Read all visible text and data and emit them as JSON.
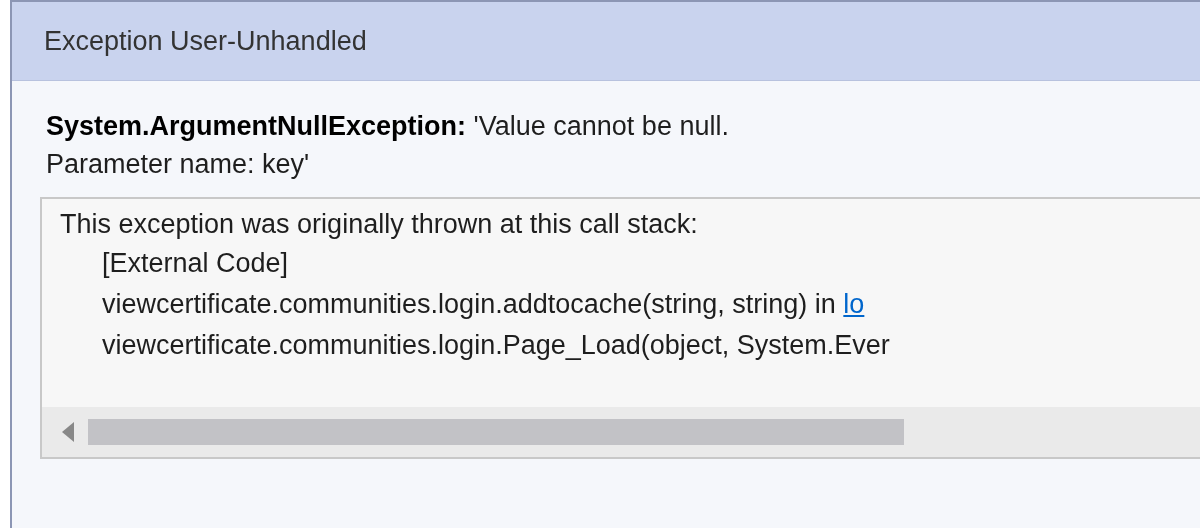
{
  "dialog": {
    "title": "Exception User-Unhandled"
  },
  "exception": {
    "type": "System.ArgumentNullException:",
    "message": "'Value cannot be null.",
    "detail": "Parameter name: key'"
  },
  "call_stack": {
    "heading": "This exception was originally thrown at this call stack:",
    "frames": [
      {
        "text": "[External Code]"
      },
      {
        "text": "viewcertificate.communities.login.addtocache(string, string) in ",
        "link": "lo"
      },
      {
        "text": "viewcertificate.communities.login.Page_Load(object, System.Ever"
      }
    ]
  }
}
